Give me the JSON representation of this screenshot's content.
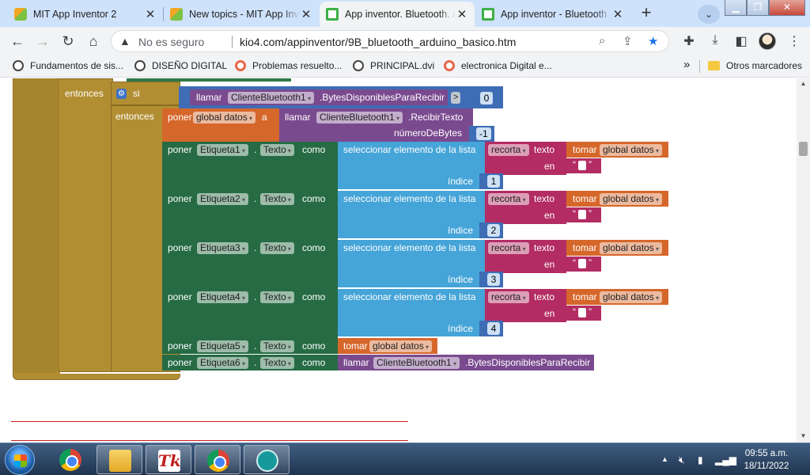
{
  "browser": {
    "tabs": [
      {
        "title": "MIT App Inventor 2",
        "icon": "mit-app-inventor-icon",
        "active": false
      },
      {
        "title": "New topics - MIT App Inventor",
        "icon": "mit-app-inventor-icon",
        "active": false
      },
      {
        "title": "App inventor. Bluetooth. Arduino",
        "icon": "app-inventor-icon",
        "active": true
      },
      {
        "title": "App inventor - Bluetooth",
        "icon": "app-inventor-icon",
        "active": false
      }
    ],
    "close_glyph": "✕",
    "new_tab_glyph": "+",
    "address": {
      "security_label": "No es seguro",
      "url": "kio4.com/appinventor/9B_bluetooth_arduino_basico.htm"
    },
    "bookmarks": [
      {
        "label": "Fundamentos de sis...",
        "icon": "globe-icon"
      },
      {
        "label": "DISEÑO DIGITAL",
        "icon": "globe-icon"
      },
      {
        "label": "Problemas resuelto...",
        "icon": "ring-icon"
      },
      {
        "label": "PRINCIPAL.dvi",
        "icon": "globe-icon"
      },
      {
        "label": "electronica Digital e...",
        "icon": "ring-icon"
      }
    ],
    "bookmarks_overflow": "»",
    "other_bookmarks": "Otros marcadores"
  },
  "blocks": {
    "entonces_outer": "entonces",
    "si": "si",
    "entonces_inner": "entonces",
    "llamar": "llamar",
    "component_bt": "ClienteBluetooth1",
    "bytes_method": ".BytesDisponiblesParaRecibir",
    "compare_op": ">",
    "compare_value": "0",
    "poner": "poner",
    "global_datos": "global datos",
    "a": "a",
    "recibir_method": ".RecibirTexto",
    "numero_bytes": "númeroDeBytes",
    "numero_bytes_value": "-1",
    "dot": ".",
    "texto_prop": "Texto",
    "como": "como",
    "select_list": "seleccionar elemento de la lista",
    "recorta": "recorta",
    "texto_word": "texto",
    "en": "en",
    "tomar": "tomar",
    "indice": "índice",
    "rows": [
      {
        "label": "Etiqueta1",
        "index": "1"
      },
      {
        "label": "Etiqueta2",
        "index": "2"
      },
      {
        "label": "Etiqueta3",
        "index": "3"
      },
      {
        "label": "Etiqueta4",
        "index": "4"
      }
    ],
    "etiqueta5": "Etiqueta5",
    "etiqueta6": "Etiqueta6"
  },
  "taskbar": {
    "time": "09:55 a.m.",
    "date": "18/11/2022",
    "tray_expand": "▲"
  },
  "colors": {
    "control_gold": "#b28e33",
    "setter_green": "#266b44",
    "list_blue": "#45a4d8",
    "component_purple": "#7a4a8f",
    "variable_orange": "#d6672b",
    "text_magenta": "#b32c63",
    "separator_red": "#cc1f1f"
  }
}
